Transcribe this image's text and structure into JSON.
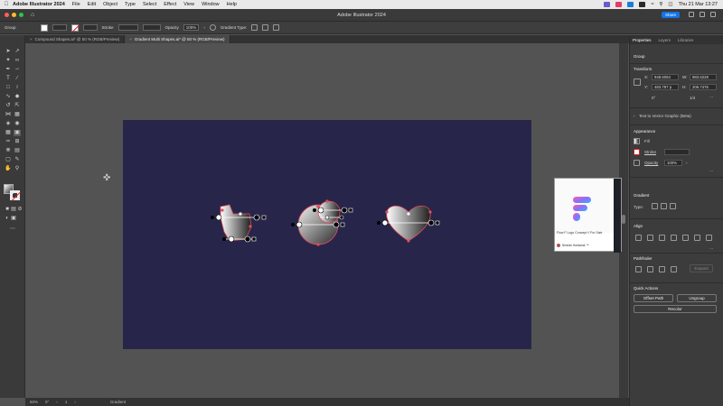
{
  "menubar": {
    "app_name": "Adobe Illustrator 2024",
    "items": [
      "File",
      "Edit",
      "Object",
      "Type",
      "Select",
      "Effect",
      "View",
      "Window",
      "Help"
    ],
    "clock": "Thu 21 Mar  13:27"
  },
  "titlebar": {
    "title": "Adobe Illustrator 2024",
    "share_label": "Share"
  },
  "controlbar": {
    "selection_label": "Group",
    "stroke_label": "Stroke",
    "opacity_label": "Opacity",
    "opacity_value": "100%",
    "gradient_type_label": "Gradient Type:"
  },
  "tabs": [
    {
      "label": "Compound Shapes.ai* @ 50 % (RGB/Preview)"
    },
    {
      "label": "Gradient Multi Shapes.ai* @ 50 % (RGB/Preview)"
    }
  ],
  "statusbar": {
    "zoom": "50%",
    "rotation": "0°",
    "artboard": "1",
    "tool": "Gradient"
  },
  "preview": {
    "caption": "Flow F Logo Concept // For Sale",
    "author": "Nimeán Harisarak ™"
  },
  "rpanel": {
    "tabs": [
      "Properties",
      "Layers",
      "Libraries"
    ],
    "selection": "Group",
    "transform": {
      "title": "Transform",
      "x_label": "X:",
      "x_value": "948.6094",
      "y_label": "Y:",
      "y_value": "483.787 p",
      "w_label": "W:",
      "w_value": "983.6228",
      "h_label": "H:",
      "h_value": "206.7476",
      "angle_value": "0°",
      "shear": "1/4"
    },
    "text_to_vector": "Text to Vector Graphic (Beta)",
    "appearance": {
      "title": "Appearance",
      "fill_label": "Fill",
      "stroke_label": "Stroke",
      "opacity_label": "Opacity",
      "opacity_value": "100%"
    },
    "gradient": {
      "title": "Gradient",
      "type_label": "Type:"
    },
    "align": {
      "title": "Align"
    },
    "pathfinder": {
      "title": "Pathfinder",
      "expand_label": "Expand"
    },
    "quick_actions": {
      "title": "Quick Actions",
      "offset_path": "Offset Path",
      "ungroup": "Ungroup",
      "recolor": "Recolor"
    }
  },
  "colors": {
    "artboard": "#27264a",
    "accent": "#1473e6",
    "gradient_handle": "#e24b5b"
  }
}
